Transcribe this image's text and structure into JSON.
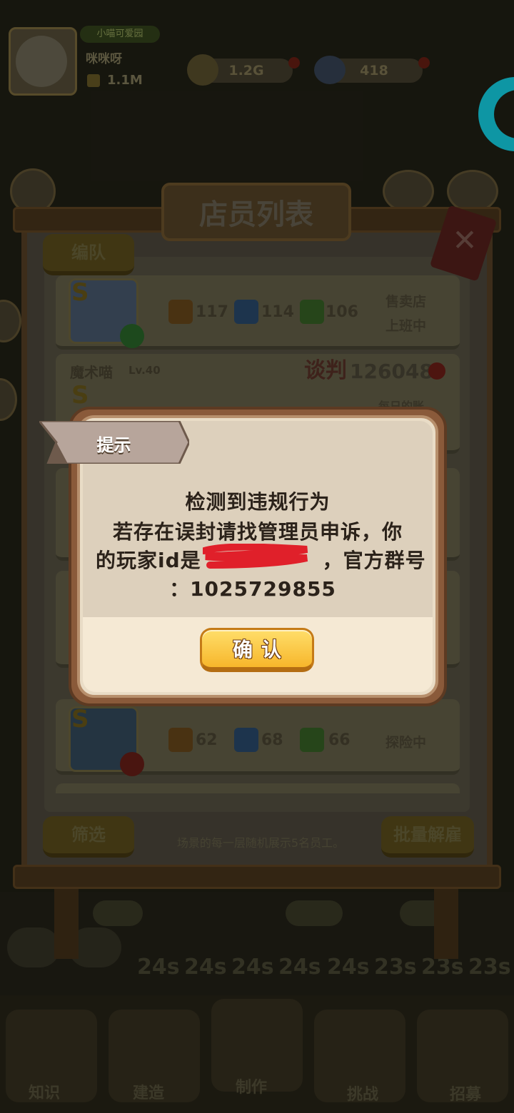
{
  "header": {
    "shop_tag": "小喵可爱园",
    "player_name": "咪咪呀",
    "trophy_value": "1.1M",
    "coins": "1.2G",
    "gems": "418"
  },
  "panel": {
    "title": "店员列表",
    "team_button": "编队",
    "filter_button": "筛选",
    "bulk_fire_button": "批量解雇",
    "tagline": "场景的每一层随机展示5名员工。",
    "close_icon": "close-x-icon"
  },
  "cards": [
    {
      "stats": [
        "117",
        "114",
        "106"
      ],
      "status": [
        "售卖店",
        "上班中"
      ],
      "mood": "happy"
    },
    {
      "name": "魔术喵",
      "level": "Lv.40",
      "talk": "谈判",
      "bargain": "126048",
      "status": [
        "每日的账"
      ]
    },
    {
      "stats": [
        "62",
        "68",
        "66"
      ],
      "status": [
        "探险中"
      ],
      "mood": "angry"
    }
  ],
  "timers": [
    "24s",
    "24s",
    "24s",
    "24s",
    "24s",
    "23s",
    "23s",
    "23s"
  ],
  "nav": [
    "知识",
    "建造",
    "制作",
    "挑战",
    "招募"
  ],
  "dialog": {
    "badge": "提示",
    "line1": "检测到违规行为",
    "line2": "若存在误封请找管理员申诉，你",
    "line3_prefix": "的玩家id是",
    "line3_suffix": "，官方群号",
    "line4": "：1025729855",
    "confirm": "确认"
  },
  "colors": {
    "confirm_fill": "#f7b62b",
    "redaction": "#e0202a",
    "accent_cyan": "#12b7c8"
  }
}
